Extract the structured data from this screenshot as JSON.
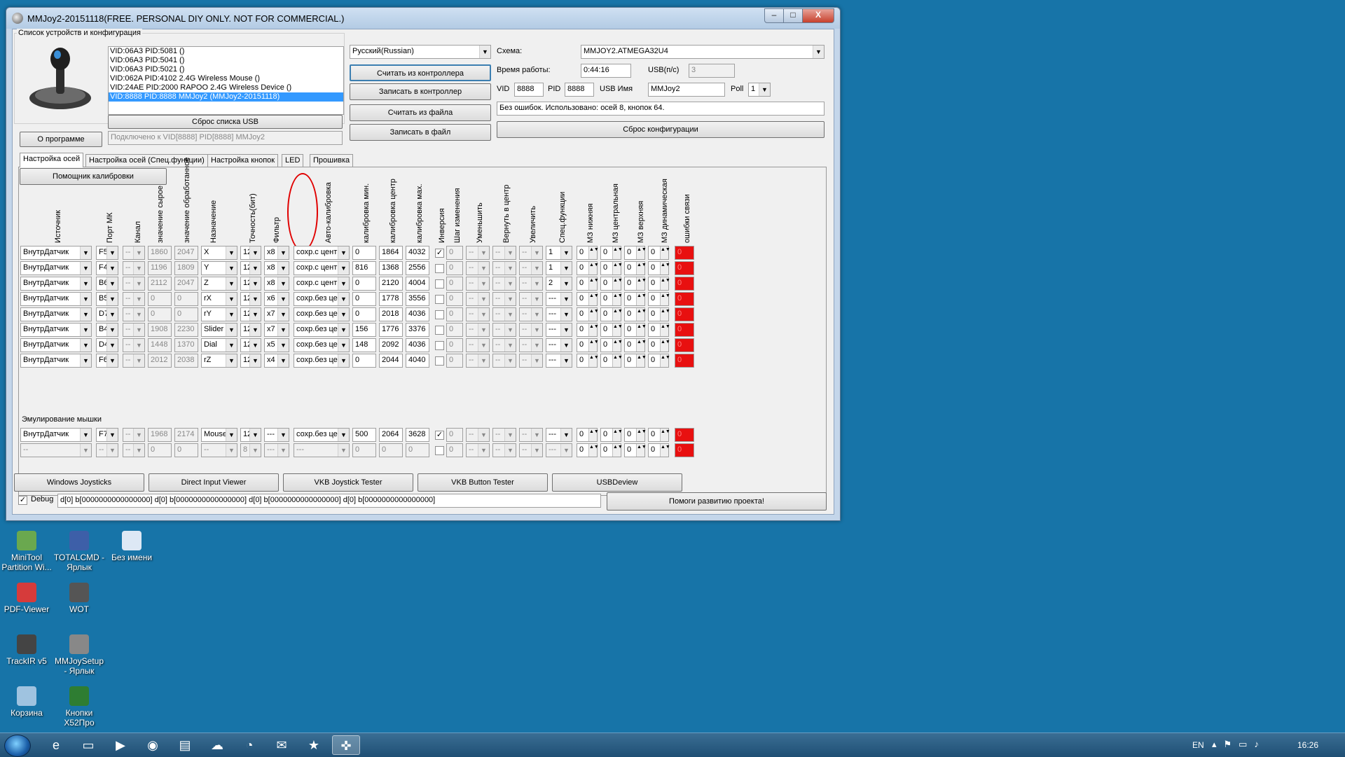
{
  "window": {
    "title": "MMJoy2-20151118(FREE. PERSONAL DIY ONLY. NOT FOR COMMERCIAL.)",
    "caption_buttons": {
      "minimize": "–",
      "maximize": "□",
      "close": "X"
    }
  },
  "devices_group": {
    "label": "Список устройств и конфигурация",
    "items": [
      "VID:06A3 PID:5081  ()",
      "VID:06A3 PID:5041  ()",
      "VID:06A3 PID:5021  ()",
      "VID:062A PID:4102 2.4G Wireless Mouse ()",
      "VID:24AE PID:2000 RAPOO 2.4G Wireless Device ()",
      "VID:8888 PID:8888 MMJoy2 (MMJoy2-20151118)"
    ],
    "selected_index": 5,
    "reset_usb_list": "Сброс списка USB",
    "about": "О программе",
    "connected_status": "Подключено к VID[8888] PID[8888] MMJoy2"
  },
  "top_controls": {
    "language": "Русский(Russian)",
    "read_controller": "Считать из контроллера",
    "write_controller": "Записать в контроллер",
    "read_file": "Считать из файла",
    "write_file": "Записать в файл",
    "scheme_label": "Схема:",
    "scheme_value": "MMJOY2.ATMEGA32U4",
    "uptime_label": "Время работы:",
    "uptime_value": "0:44:16",
    "usb_rate_label": "USB(п/с)",
    "usb_rate_value": "3",
    "vid_label": "VID",
    "vid_value": "8888",
    "pid_label": "PID",
    "pid_value": "8888",
    "usb_name_label": "USB Имя",
    "usb_name_value": "MMJoy2",
    "poll_label": "Poll",
    "poll_value": "1",
    "status_text": "Без ошибок. Использовано: осей 8, кнопок 64.",
    "reset_config": "Сброс конфигурации"
  },
  "tabs": [
    "Настройка осей",
    "Настройка осей (Спец.функции)",
    "Настройка кнопок",
    "LED",
    "Прошивка"
  ],
  "active_tab": 0,
  "calibration_helper": "Помощник калибровки",
  "columns": [
    "Источник",
    "Порт МК",
    "Канал",
    "значение сырое",
    "значение обработанное",
    "Назначение",
    "Точность(бит)",
    "Фильтр",
    "Авто-калибровка",
    "калибровка мин.",
    "калибровка центр",
    "калибровка мах.",
    "Инверсия",
    "Шаг изменения",
    "Уменьшить",
    "Вернуть в центр",
    "Увеличить",
    "Спец.функции",
    "МЗ нижняя",
    "МЗ центральная",
    "МЗ верхняя",
    "МЗ динамическая",
    "ошибки связи"
  ],
  "rows": [
    {
      "source": "ВнутрДатчик",
      "port": "F5",
      "channel": "--",
      "raw": "1860",
      "proc": "2047",
      "assign": "X",
      "prec": "12",
      "filter": "x8",
      "auto": "сохр.с центром",
      "cmin": "0",
      "ccen": "1864",
      "cmax": "4032",
      "inv": true,
      "step": "0",
      "dec": "--",
      "ret": "--",
      "inc": "--",
      "spec": "1",
      "dzl": "0",
      "dzc": "0",
      "dzu": "0",
      "dzd": "0",
      "err": "0"
    },
    {
      "source": "ВнутрДатчик",
      "port": "F4",
      "channel": "--",
      "raw": "1196",
      "proc": "1809",
      "assign": "Y",
      "prec": "12",
      "filter": "x8",
      "auto": "сохр.с центром",
      "cmin": "816",
      "ccen": "1368",
      "cmax": "2556",
      "inv": false,
      "step": "0",
      "dec": "--",
      "ret": "--",
      "inc": "--",
      "spec": "1",
      "dzl": "0",
      "dzc": "0",
      "dzu": "0",
      "dzd": "0",
      "err": "0"
    },
    {
      "source": "ВнутрДатчик",
      "port": "B6",
      "channel": "--",
      "raw": "2112",
      "proc": "2047",
      "assign": "Z",
      "prec": "12",
      "filter": "x8",
      "auto": "сохр.с центром",
      "cmin": "0",
      "ccen": "2120",
      "cmax": "4004",
      "inv": false,
      "step": "0",
      "dec": "--",
      "ret": "--",
      "inc": "--",
      "spec": "2",
      "dzl": "0",
      "dzc": "0",
      "dzu": "0",
      "dzd": "0",
      "err": "0"
    },
    {
      "source": "ВнутрДатчик",
      "port": "B5",
      "channel": "--",
      "raw": "0",
      "proc": "0",
      "assign": "rX",
      "prec": "12",
      "filter": "x6",
      "auto": "сохр.без центра",
      "cmin": "0",
      "ccen": "1778",
      "cmax": "3556",
      "inv": false,
      "step": "0",
      "dec": "--",
      "ret": "--",
      "inc": "--",
      "spec": "---",
      "dzl": "0",
      "dzc": "0",
      "dzu": "0",
      "dzd": "0",
      "err": "0"
    },
    {
      "source": "ВнутрДатчик",
      "port": "D7",
      "channel": "--",
      "raw": "0",
      "proc": "0",
      "assign": "rY",
      "prec": "12",
      "filter": "x7",
      "auto": "сохр.без центра",
      "cmin": "0",
      "ccen": "2018",
      "cmax": "4036",
      "inv": false,
      "step": "0",
      "dec": "--",
      "ret": "--",
      "inc": "--",
      "spec": "---",
      "dzl": "0",
      "dzc": "0",
      "dzu": "0",
      "dzd": "0",
      "err": "0"
    },
    {
      "source": "ВнутрДатчик",
      "port": "B4",
      "channel": "--",
      "raw": "1908",
      "proc": "2230",
      "assign": "Slider",
      "prec": "12",
      "filter": "x7",
      "auto": "сохр.без центра",
      "cmin": "156",
      "ccen": "1776",
      "cmax": "3376",
      "inv": false,
      "step": "0",
      "dec": "--",
      "ret": "--",
      "inc": "--",
      "spec": "---",
      "dzl": "0",
      "dzc": "0",
      "dzu": "0",
      "dzd": "0",
      "err": "0"
    },
    {
      "source": "ВнутрДатчик",
      "port": "D4",
      "channel": "--",
      "raw": "1448",
      "proc": "1370",
      "assign": "Dial",
      "prec": "12",
      "filter": "x5",
      "auto": "сохр.без центра",
      "cmin": "148",
      "ccen": "2092",
      "cmax": "4036",
      "inv": false,
      "step": "0",
      "dec": "--",
      "ret": "--",
      "inc": "--",
      "spec": "---",
      "dzl": "0",
      "dzc": "0",
      "dzu": "0",
      "dzd": "0",
      "err": "0"
    },
    {
      "source": "ВнутрДатчик",
      "port": "F6",
      "channel": "--",
      "raw": "2012",
      "proc": "2038",
      "assign": "rZ",
      "prec": "12",
      "filter": "x4",
      "auto": "сохр.без центра",
      "cmin": "0",
      "ccen": "2044",
      "cmax": "4040",
      "inv": false,
      "step": "0",
      "dec": "--",
      "ret": "--",
      "inc": "--",
      "spec": "---",
      "dzl": "0",
      "dzc": "0",
      "dzu": "0",
      "dzd": "0",
      "err": "0"
    }
  ],
  "mouse_label": "Эмулирование мышки",
  "mouse_rows": [
    {
      "source": "ВнутрДатчик",
      "port": "F7",
      "channel": "--",
      "raw": "1968",
      "proc": "2174",
      "assign": "Mouse Y",
      "prec": "12",
      "filter": "---",
      "auto": "сохр.без центра",
      "cmin": "500",
      "ccen": "2064",
      "cmax": "3628",
      "inv": true,
      "step": "0",
      "dec": "--",
      "ret": "--",
      "inc": "--",
      "spec": "---",
      "dzl": "0",
      "dzc": "0",
      "dzu": "0",
      "dzd": "0",
      "err": "0"
    },
    {
      "source": "--",
      "port": "--",
      "channel": "--",
      "raw": "0",
      "proc": "0",
      "assign": "--",
      "prec": "8",
      "filter": "---",
      "auto": "---",
      "cmin": "0",
      "ccen": "0",
      "cmax": "0",
      "inv": false,
      "step": "0",
      "dec": "--",
      "ret": "--",
      "inc": "--",
      "spec": "---",
      "dzl": "0",
      "dzc": "0",
      "dzu": "0",
      "dzd": "0",
      "err": "0"
    }
  ],
  "bottom_buttons": [
    "Windows Joysticks",
    "Direct Input Viewer",
    "VKB Joystick Tester",
    "VKB Button Tester",
    "USBDeview"
  ],
  "debug": {
    "label": "Debug",
    "checked": true,
    "text": "d[0] b[0000000000000000]   d[0] b[0000000000000000]   d[0] b[0000000000000000]   d[0] b[0000000000000000]"
  },
  "help_project": "Помоги развитию проекта!",
  "desktop_icons": [
    {
      "label": "MiniTool Partition Wi...",
      "icon": "minitool-icon",
      "color": "#6aa84f"
    },
    {
      "label": "TOTALCMD - Ярлык",
      "icon": "totalcmd-icon",
      "color": "#3d5fa8"
    },
    {
      "label": "Без имени",
      "icon": "file-icon",
      "color": "#dde8f5"
    },
    {
      "label": "PDF-Viewer",
      "icon": "pdf-icon",
      "color": "#d63b3b"
    },
    {
      "label": "WOT",
      "icon": "wot-icon",
      "color": "#555555"
    },
    {
      "label": "TrackIR v5",
      "icon": "trackir-icon",
      "color": "#444444"
    },
    {
      "label": "MMJoySetup - Ярлык",
      "icon": "joystick-icon",
      "color": "#888888"
    },
    {
      "label": "Корзина",
      "icon": "recycle-bin-icon",
      "color": "#9fc3e0"
    },
    {
      "label": "Кнопки X52Про",
      "icon": "excel-icon",
      "color": "#2e7d32"
    }
  ],
  "taskbar": {
    "language": "EN",
    "time": "16:26",
    "pinned": [
      "ie-icon",
      "explorer-icon",
      "media-player-icon",
      "chrome-icon",
      "app-icon",
      "cloud-icon",
      "skype-icon",
      "mail-icon",
      "star-icon",
      "mmjoy-icon"
    ]
  }
}
